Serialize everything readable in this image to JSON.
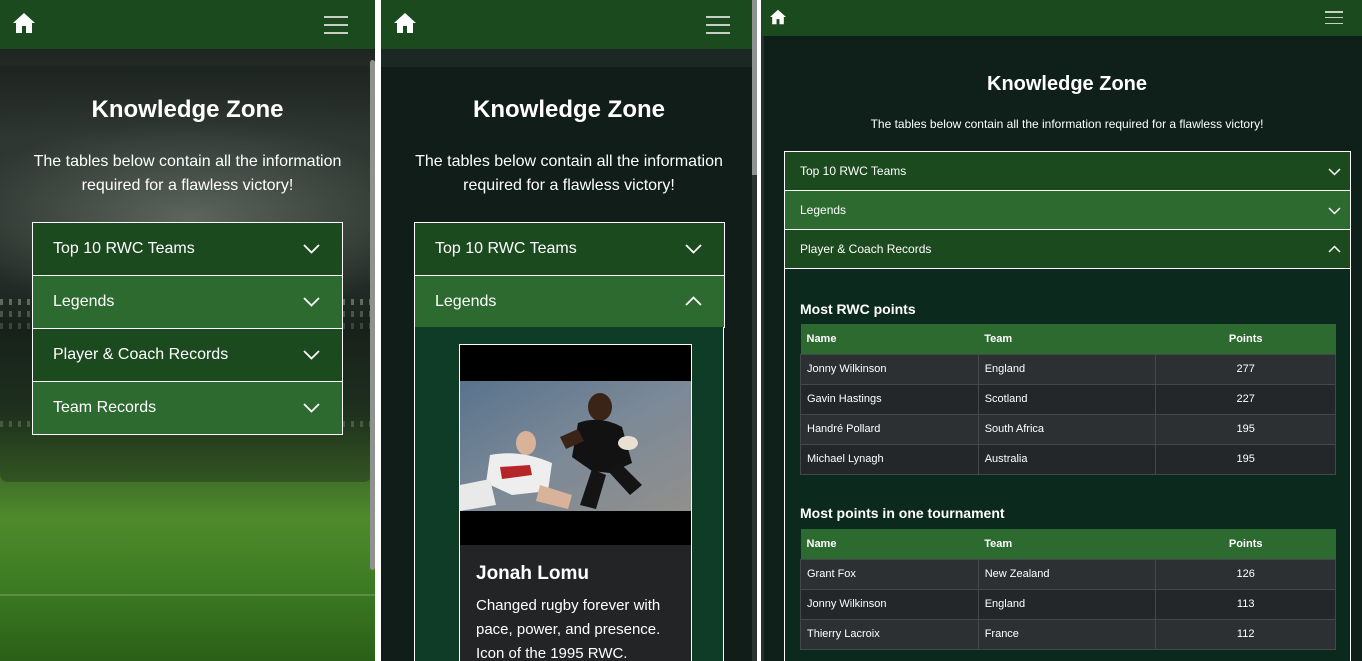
{
  "header": {
    "home_icon": "home-icon",
    "menu_icon": "hamburger-menu-icon"
  },
  "knowledge_zone": {
    "title": "Knowledge Zone",
    "subtitle": "The tables below contain all the information required for a flawless victory!"
  },
  "accordion": {
    "items": [
      {
        "label": "Top 10 RWC Teams"
      },
      {
        "label": "Legends"
      },
      {
        "label": "Player & Coach Records"
      },
      {
        "label": "Team Records"
      }
    ],
    "chevron_down_icon": "chevron-down-icon",
    "chevron_up_icon": "chevron-up-icon"
  },
  "legend_card": {
    "name": "Jonah Lomu",
    "description": "Changed rugby forever with pace, power, and presence. Icon of the 1995 RWC."
  },
  "records": {
    "columns": [
      "Name",
      "Team",
      "Points"
    ],
    "most_rwc_points": {
      "title": "Most RWC points",
      "rows": [
        {
          "name": "Jonny Wilkinson",
          "team": "England",
          "points": "277"
        },
        {
          "name": "Gavin Hastings",
          "team": "Scotland",
          "points": "227"
        },
        {
          "name": "Handré Pollard",
          "team": "South Africa",
          "points": "195"
        },
        {
          "name": "Michael Lynagh",
          "team": "Australia",
          "points": "195"
        }
      ]
    },
    "most_points_one_tournament": {
      "title": "Most points in one tournament",
      "rows": [
        {
          "name": "Grant Fox",
          "team": "New Zealand",
          "points": "126"
        },
        {
          "name": "Jonny Wilkinson",
          "team": "England",
          "points": "113"
        },
        {
          "name": "Thierry Lacroix",
          "team": "France",
          "points": "112"
        }
      ]
    }
  },
  "colors": {
    "header_green": "#1c4a1f",
    "accordion_dark": "#1c4a1f",
    "accordion_light": "#2c6a2f",
    "legend_panel": "#0e3c26",
    "table_header": "#2c6a2f"
  }
}
